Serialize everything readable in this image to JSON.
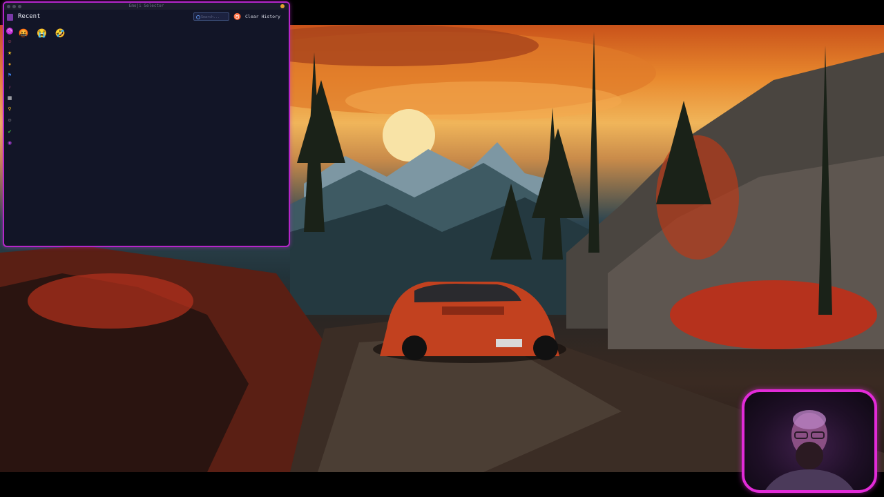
{
  "window": {
    "title": "Emoji Selector",
    "section_title": "Recent"
  },
  "search": {
    "placeholder": "Search..."
  },
  "toolbar": {
    "clear_history_label": "Clear History"
  },
  "sidebar": {
    "categories": [
      {
        "icon": "clock-icon",
        "glyph": "◷",
        "color": "#ffffff"
      },
      {
        "icon": "smiley-icon",
        "glyph": "☺",
        "color": "#e05a7a"
      },
      {
        "icon": "star-icon",
        "glyph": "★",
        "color": "#f0c020"
      },
      {
        "icon": "food-icon",
        "glyph": "●",
        "color": "#e8a020"
      },
      {
        "icon": "flag-icon",
        "glyph": "⚑",
        "color": "#3a7ae0"
      },
      {
        "icon": "activity-icon",
        "glyph": "♪",
        "color": "#c04080"
      },
      {
        "icon": "calculator-icon",
        "glyph": "▦",
        "color": "#e0e0e0"
      },
      {
        "icon": "person-icon",
        "glyph": "⚲",
        "color": "#f0c020"
      },
      {
        "icon": "face-outline-icon",
        "glyph": "☺",
        "color": "#c0c0c0"
      },
      {
        "icon": "checkmark-icon",
        "glyph": "✔",
        "color": "#40c040"
      },
      {
        "icon": "globe-icon",
        "glyph": "◉",
        "color": "#b040e0"
      }
    ]
  },
  "recent_emojis": [
    "🤬",
    "😭",
    "🤣"
  ],
  "colors": {
    "accent": "#c026d3",
    "window_bg": "#121527",
    "webcam_border": "#e22bd8"
  }
}
